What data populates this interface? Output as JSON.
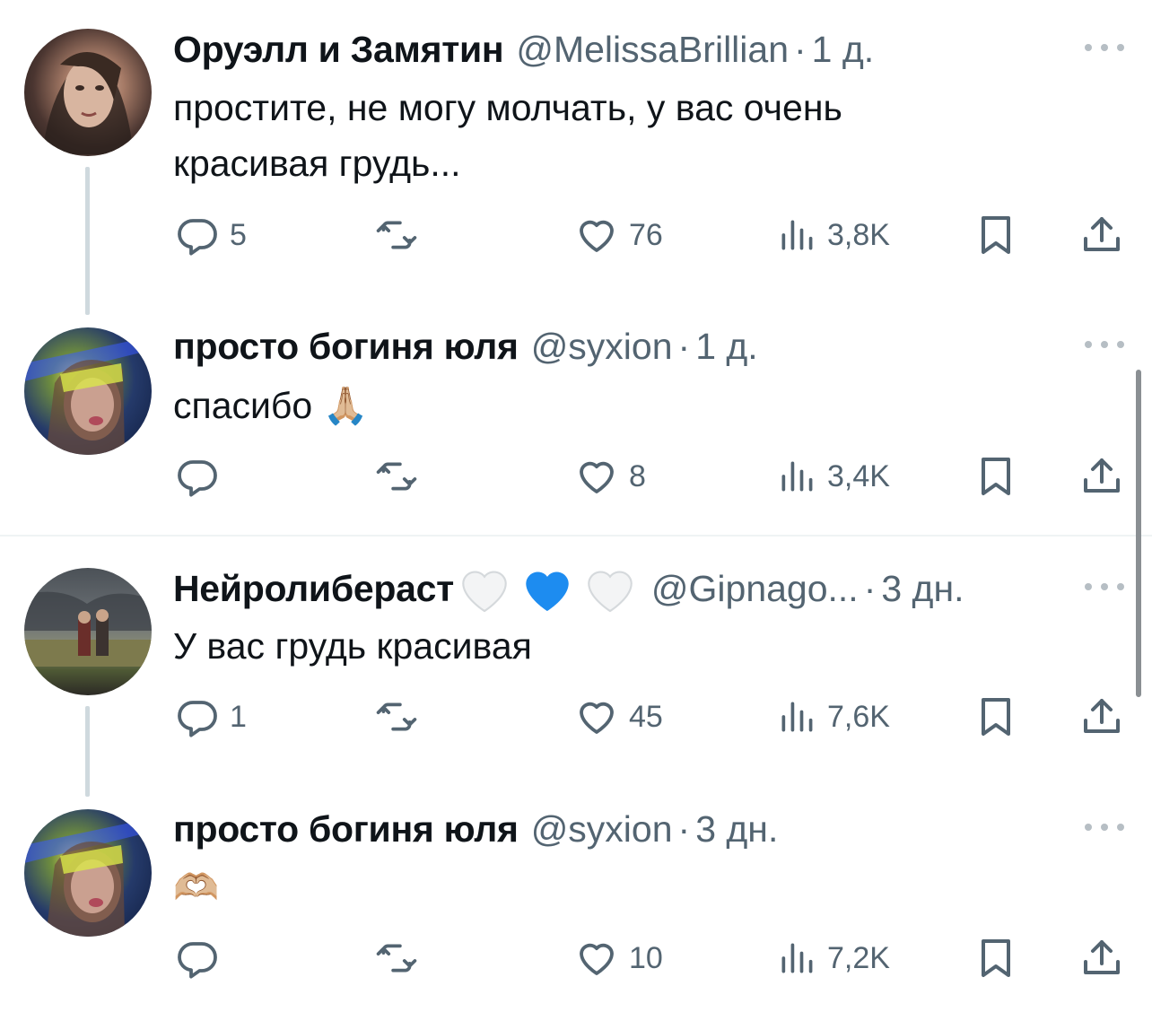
{
  "tweets": [
    {
      "name": "Оруэлл и Замятин",
      "handle": "@MelissaBrillian",
      "time": "1 д.",
      "text_lines": [
        "простите, не могу молчать, у вас очень",
        "красивая грудь..."
      ],
      "replies": "5",
      "retweets": "",
      "likes": "76",
      "views": "3,8K"
    },
    {
      "name": "просто богиня юля",
      "handle": "@syxion",
      "time": "1 д.",
      "text_lines": [
        "спасибо 🙏🏼"
      ],
      "replies": "",
      "retweets": "",
      "likes": "8",
      "views": "3,4K"
    },
    {
      "name": "Нейролибераст",
      "name_emoji": "🤍💙🤍",
      "handle": "@Gipnago...",
      "time": "3 дн.",
      "text_lines": [
        "У вас грудь красивая"
      ],
      "replies": "1",
      "retweets": "",
      "likes": "45",
      "views": "7,6K"
    },
    {
      "name": "просто богиня юля",
      "handle": "@syxion",
      "time": "3 дн.",
      "text_lines": [
        "🫶🏼"
      ],
      "replies": "",
      "retweets": "",
      "likes": "10",
      "views": "7,2K"
    }
  ],
  "icons": {
    "reply": "reply-icon",
    "retweet": "retweet-icon",
    "like": "heart-icon",
    "views": "views-icon",
    "bookmark": "bookmark-icon",
    "share": "share-icon",
    "more": "more-icon"
  },
  "colors": {
    "text": "#0f1419",
    "secondary": "#536471",
    "thread_line": "#cfd9de",
    "heart_blue": "#1d8cf0"
  }
}
